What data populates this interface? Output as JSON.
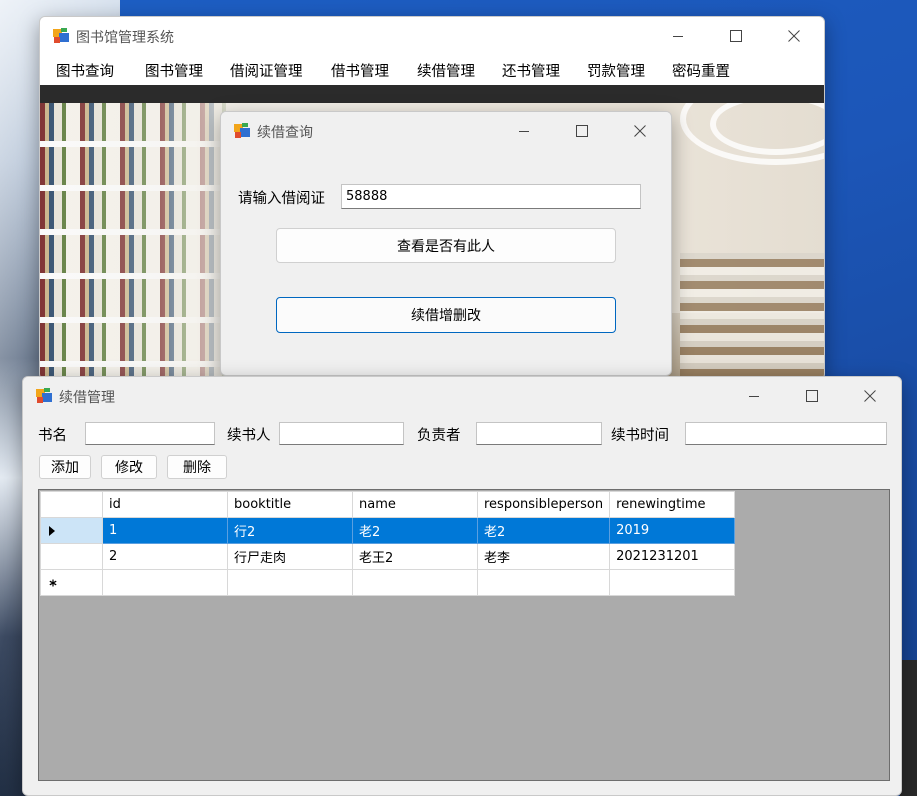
{
  "main_window": {
    "title": "图书馆管理系统",
    "menu": [
      "图书查询",
      "图书管理",
      "借阅证管理",
      "借书管理",
      "续借管理",
      "还书管理",
      "罚款管理",
      "密码重置"
    ]
  },
  "query_dialog": {
    "title": "续借查询",
    "card_label": "请输入借阅证",
    "card_value": "58888",
    "check_button": "查看是否有此人",
    "edit_button": "续借增删改"
  },
  "renew_window": {
    "title": "续借管理",
    "fields": {
      "book_label": "书名",
      "renewer_label": "续书人",
      "manager_label": "负责者",
      "time_label": "续书时间"
    },
    "buttons": {
      "add": "添加",
      "edit": "修改",
      "delete": "删除"
    },
    "table": {
      "columns": [
        "id",
        "booktitle",
        "name",
        "responsibleperson",
        "renewingtime"
      ],
      "rows": [
        [
          "1",
          "行2",
          "老2",
          "老2",
          "2019"
        ],
        [
          "2",
          "行尸走肉",
          "老王2",
          "老李",
          "2021231201"
        ]
      ],
      "selected_row": 0
    }
  },
  "colors": {
    "selection": "#0078d7",
    "primary_border": "#0067c0",
    "grid_background": "#ababab",
    "desktop": "#1d5fc4"
  }
}
